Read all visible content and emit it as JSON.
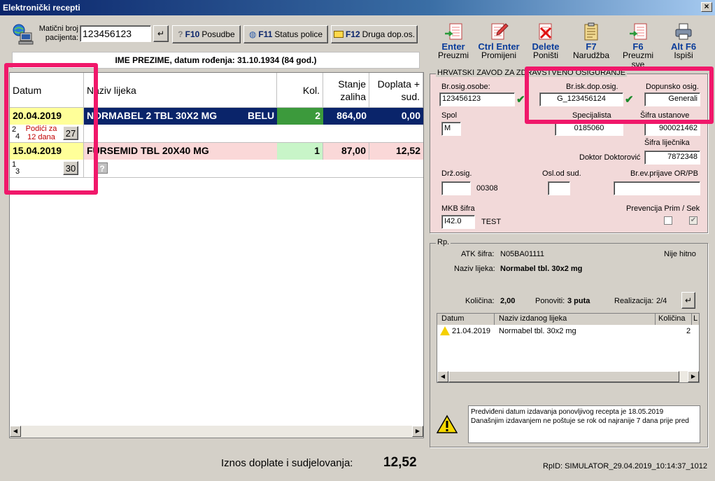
{
  "window": {
    "title": "Elektronički recepti"
  },
  "patient": {
    "mbo_label": "Matični broj pacijenta:",
    "mbo_value": "123456123",
    "name_line": "IME PREZIME, datum rođenja: 31.10.1934 (84 god.)"
  },
  "top_buttons": {
    "posudbe": {
      "key": "F10",
      "label": "Posudbe"
    },
    "status": {
      "key": "F11",
      "label": "Status police"
    },
    "druga": {
      "key": "F12",
      "label": "Druga dop.os."
    }
  },
  "toolbar": [
    {
      "key": "Enter",
      "label": "Preuzmi"
    },
    {
      "key": "Ctrl Enter",
      "label": "Promijeni"
    },
    {
      "key": "Delete",
      "label": "Poništi"
    },
    {
      "key": "F7",
      "label": "Narudžba"
    },
    {
      "key": "F6",
      "label": "Preuzmi sve"
    },
    {
      "key": "Alt F6",
      "label": "Ispiši"
    }
  ],
  "grid": {
    "headers": {
      "datum": "Datum",
      "naziv": "Naziv lijeka",
      "kol": "Kol.",
      "stanje": "Stanje zaliha",
      "doplata": "Doplata + sud."
    },
    "rows": [
      {
        "datum": "20.04.2019",
        "naziv": "NORMABEL  2 TBL 30X2 MG",
        "tag": "BELU",
        "kol": "2",
        "stanje": "864,00",
        "doplata": "0,00",
        "fraction_top": "2",
        "fraction_bottom": "4",
        "note": "Podići za 12 dana",
        "days": "27"
      },
      {
        "datum": "15.04.2019",
        "naziv": "FURSEMID TBL 20X40 MG",
        "tag": "",
        "kol": "1",
        "stanje": "87,00",
        "doplata": "12,52",
        "fraction_top": "1",
        "fraction_bottom": "3",
        "note": "",
        "days": "30"
      }
    ]
  },
  "footer": {
    "iznos_label": "Iznos doplate i sudjelovanja:",
    "iznos_value": "12,52",
    "rpid": "RpID: SIMULATOR_29.04.2019_10:14:37_1012"
  },
  "hzzo": {
    "title": "HRVATSKI ZAVOD ZA ZDRAVSTVENO OSIGURANJE",
    "br_osig_label": "Br.osig.osobe:",
    "br_osig_value": "123456123",
    "br_isk_label": "Br.isk.dop.osig.",
    "br_isk_value": "G_123456124",
    "dopunsko_label": "Dopunsko osig.",
    "dopunsko_value": "Generali",
    "spol_label": "Spol",
    "spol_value": "M",
    "specijalista_label": "Specijalista",
    "specijalista_value": "0185060",
    "sifra_ust_label": "Šifra ustanove",
    "sifra_ust_value": "900021462",
    "sifra_lij_label": "Šifra liječnika",
    "doktor_label": "Doktor Doktorović",
    "doktor_value": "7872348",
    "drz_label": "Drž.osig.",
    "drz_value": "00308",
    "osl_label": "Osl.od sud.",
    "brev_label": "Br.ev.prijave OR/PB",
    "mkb_label": "MKB šifra",
    "mkb_value": "I42.0",
    "mkb_text": "TEST",
    "prev_label": "Prevencija Prim / Sek"
  },
  "rp": {
    "title": "Rp.",
    "atk_label": "ATK šifra:",
    "atk_value": "N05BA01111",
    "nije_hitno": "Nije hitno",
    "naziv_label": "Naziv lijeka:",
    "naziv_value": "Normabel tbl. 30x2 mg",
    "kolicina_label": "Količina:",
    "kolicina_value": "2,00",
    "ponoviti_label": "Ponoviti:",
    "ponoviti_value": "3 puta",
    "realizacija_label": "Realizacija:",
    "realizacija_value": "2/4",
    "list_headers": [
      "Datum",
      "Naziv izdanog lijeka",
      "Količina",
      "L"
    ],
    "list_rows": [
      {
        "datum": "21.04.2019",
        "naziv": "Normabel tbl. 30x2 mg",
        "kolicina": "2"
      }
    ],
    "warning_line1": "Predviđeni datum izdavanja ponovljivog recepta je 18.05.2019",
    "warning_line2": "Današnjim izdavanjem ne poštuje se rok od najranije 7 dana prije pred"
  },
  "colors": {
    "accent_pink": "#f0186a",
    "selected_row": "#0a246a",
    "panel_pink": "#f2d9d9",
    "yellow": "#ffff99"
  }
}
